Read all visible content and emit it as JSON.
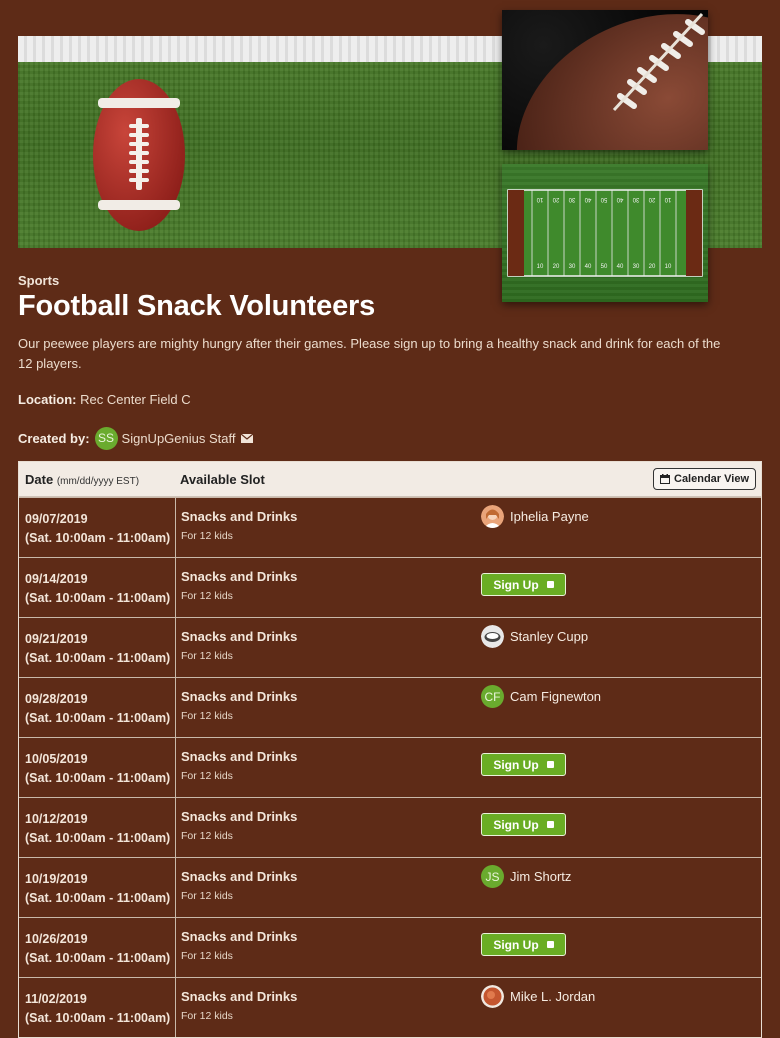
{
  "header": {
    "category": "Sports",
    "title": "Football Snack Volunteers",
    "description": "Our peewee players are mighty hungry after their games. Please sign up to bring a healthy snack and drink for each of the 12 players.",
    "location_label": "Location:",
    "location_value": "Rec Center Field C",
    "created_by_label": "Created by:",
    "creator_initials": "SS",
    "creator_name": "SignUpGenius Staff"
  },
  "field_numbers": {
    "top": [
      "10",
      "20",
      "30",
      "40",
      "50",
      "40",
      "30",
      "20",
      "10"
    ],
    "bottom": [
      "10",
      "20",
      "30",
      "40",
      "50",
      "40",
      "30",
      "20",
      "10"
    ]
  },
  "table": {
    "col_date": "Date",
    "col_date_hint": "(mm/dd/yyyy EST)",
    "col_slot": "Available Slot",
    "calendar_button": "Calendar View",
    "signup_label": "Sign Up",
    "rows": [
      {
        "date": "09/07/2019",
        "time": "(Sat. 10:00am - 11:00am)",
        "slot": "Snacks and Drinks",
        "qty": "For 12 kids",
        "name": "Iphelia Payne"
      },
      {
        "date": "09/14/2019",
        "time": "(Sat. 10:00am - 11:00am)",
        "slot": "Snacks and Drinks",
        "qty": "For 12 kids"
      },
      {
        "date": "09/21/2019",
        "time": "(Sat. 10:00am - 11:00am)",
        "slot": "Snacks and Drinks",
        "qty": "For 12 kids",
        "name": "Stanley Cupp"
      },
      {
        "date": "09/28/2019",
        "time": "(Sat. 10:00am - 11:00am)",
        "slot": "Snacks and Drinks",
        "qty": "For 12 kids",
        "name": "Cam Fignewton",
        "initials": "CF"
      },
      {
        "date": "10/05/2019",
        "time": "(Sat. 10:00am - 11:00am)",
        "slot": "Snacks and Drinks",
        "qty": "For 12 kids"
      },
      {
        "date": "10/12/2019",
        "time": "(Sat. 10:00am - 11:00am)",
        "slot": "Snacks and Drinks",
        "qty": "For 12 kids"
      },
      {
        "date": "10/19/2019",
        "time": "(Sat. 10:00am - 11:00am)",
        "slot": "Snacks and Drinks",
        "qty": "For 12 kids",
        "name": "Jim Shortz",
        "initials": "JS"
      },
      {
        "date": "10/26/2019",
        "time": "(Sat. 10:00am - 11:00am)",
        "slot": "Snacks and Drinks",
        "qty": "For 12 kids"
      },
      {
        "date": "11/02/2019",
        "time": "(Sat. 10:00am - 11:00am)",
        "slot": "Snacks and Drinks",
        "qty": "For 12 kids",
        "name": "Mike L. Jordan"
      }
    ]
  }
}
